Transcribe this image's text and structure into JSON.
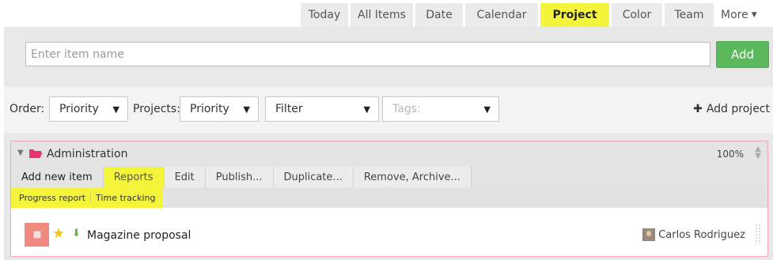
{
  "tabs": [
    {
      "label": "Today"
    },
    {
      "label": "All Items"
    },
    {
      "label": "Date"
    },
    {
      "label": "Calendar"
    },
    {
      "label": "Project",
      "active": true
    },
    {
      "label": "Color"
    },
    {
      "label": "Team"
    },
    {
      "label": "More"
    }
  ],
  "new_item": {
    "placeholder": "Enter item name",
    "add_label": "Add"
  },
  "filters": {
    "order_label": "Order:",
    "order_value": "Priority",
    "projects_label": "Projects:",
    "projects_value": "Priority",
    "filter_value": "Filter",
    "tags_placeholder": "Tags:",
    "add_project_label": "Add project"
  },
  "project": {
    "name": "Administration",
    "percent": "100%",
    "menu": [
      "Add new item",
      "Reports",
      "Edit",
      "Publish...",
      "Duplicate...",
      "Remove, Archive..."
    ],
    "active_menu": "Reports",
    "submenu": [
      "Progress report",
      "Time tracking"
    ],
    "items": [
      {
        "name": "Magazine proposal",
        "assignee": "Carlos Rodriguez",
        "starred": true
      }
    ]
  },
  "colors": {
    "highlight": "#f4f53a",
    "add_button": "#5cb85c",
    "project_border": "#f2a5b8",
    "folder_icon": "#e8336d",
    "priority": "#f08a80",
    "star": "#f5c518"
  }
}
